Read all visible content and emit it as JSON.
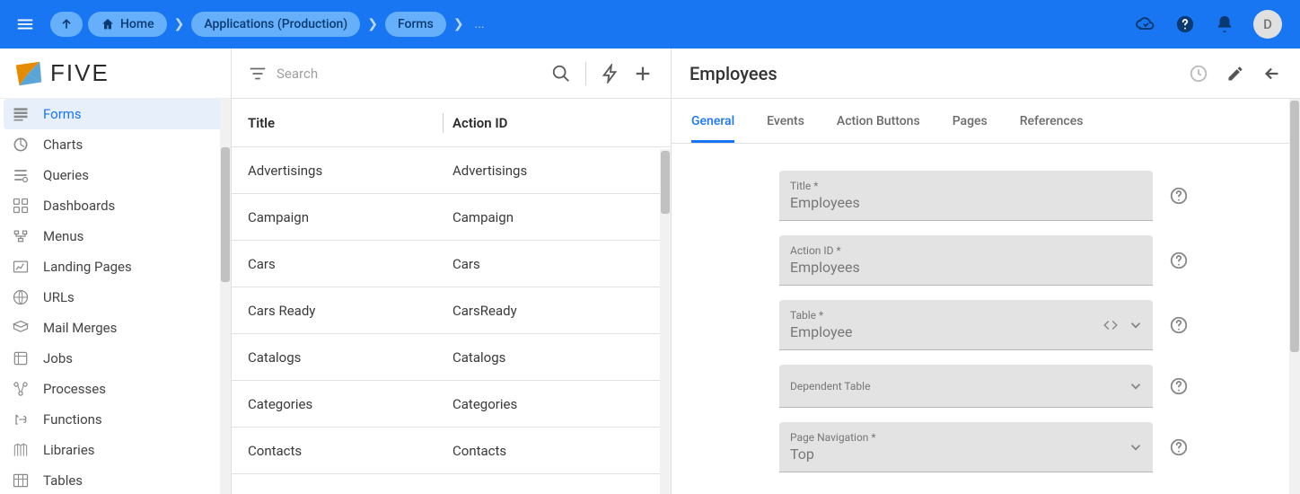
{
  "avatar": "D",
  "breadcrumb": {
    "home": "Home",
    "applications": "Applications (Production)",
    "forms": "Forms",
    "dots": "..."
  },
  "brand": "FIVE",
  "sidebar": {
    "items": [
      {
        "label": "Forms"
      },
      {
        "label": "Charts"
      },
      {
        "label": "Queries"
      },
      {
        "label": "Dashboards"
      },
      {
        "label": "Menus"
      },
      {
        "label": "Landing Pages"
      },
      {
        "label": "URLs"
      },
      {
        "label": "Mail Merges"
      },
      {
        "label": "Jobs"
      },
      {
        "label": "Processes"
      },
      {
        "label": "Functions"
      },
      {
        "label": "Libraries"
      },
      {
        "label": "Tables"
      }
    ]
  },
  "listSearchPlaceholder": "Search",
  "listColumns": {
    "title": "Title",
    "actionId": "Action ID"
  },
  "listRows": [
    {
      "title": "Advertisings",
      "actionId": "Advertisings"
    },
    {
      "title": "Campaign",
      "actionId": "Campaign"
    },
    {
      "title": "Cars",
      "actionId": "Cars"
    },
    {
      "title": "Cars Ready",
      "actionId": "CarsReady"
    },
    {
      "title": "Catalogs",
      "actionId": "Catalogs"
    },
    {
      "title": "Categories",
      "actionId": "Categories"
    },
    {
      "title": "Contacts",
      "actionId": "Contacts"
    }
  ],
  "detail": {
    "heading": "Employees",
    "tabs": [
      "General",
      "Events",
      "Action Buttons",
      "Pages",
      "References"
    ],
    "fields": {
      "title": {
        "label": "Title *",
        "value": "Employees"
      },
      "actionId": {
        "label": "Action ID *",
        "value": "Employees"
      },
      "table": {
        "label": "Table *",
        "value": "Employee"
      },
      "dependentTable": {
        "label": "Dependent Table",
        "value": ""
      },
      "pageNav": {
        "label": "Page Navigation *",
        "value": "Top"
      }
    }
  }
}
